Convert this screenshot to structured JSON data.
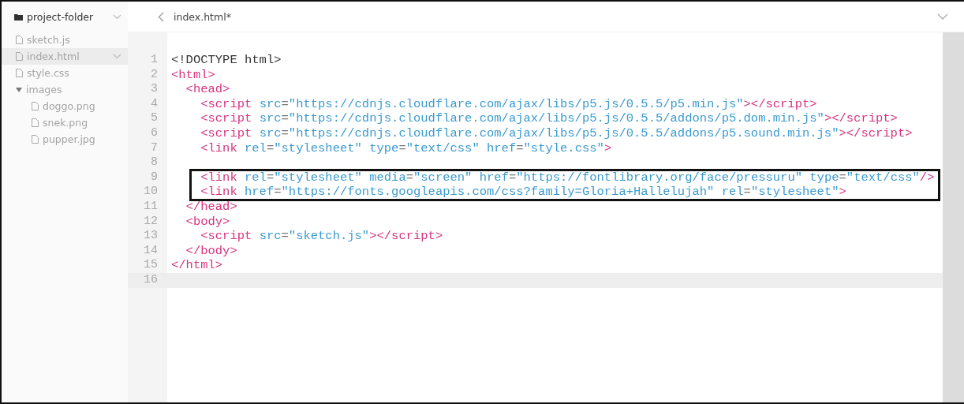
{
  "sidebar": {
    "title": "project-folder",
    "items": [
      {
        "label": "sketch.js",
        "kind": "file",
        "selected": false
      },
      {
        "label": "index.html",
        "kind": "file",
        "selected": true
      },
      {
        "label": "style.css",
        "kind": "file",
        "selected": false
      },
      {
        "label": "images",
        "kind": "folder",
        "selected": false,
        "expanded": true,
        "children": [
          {
            "label": "doggo.png",
            "kind": "file",
            "selected": false
          },
          {
            "label": "snek.png",
            "kind": "file",
            "selected": false
          },
          {
            "label": "pupper.jpg",
            "kind": "file",
            "selected": false
          }
        ]
      }
    ]
  },
  "tab": {
    "label": "index.html*"
  },
  "editor": {
    "lines": [
      {
        "number": "1",
        "current": false,
        "boxed": false,
        "tokens": [
          {
            "kind": "plain",
            "text": "<!DOCTYPE html>"
          }
        ]
      },
      {
        "number": "2",
        "current": false,
        "boxed": false,
        "tokens": [
          {
            "kind": "tag",
            "text": "<html>"
          }
        ]
      },
      {
        "number": "3",
        "current": false,
        "boxed": false,
        "tokens": [
          {
            "kind": "tag",
            "text": "  <head>"
          }
        ]
      },
      {
        "number": "4",
        "current": false,
        "boxed": false,
        "tokens": [
          {
            "kind": "tag",
            "text": "    <script"
          },
          {
            "kind": "attr",
            "text": " src"
          },
          {
            "kind": "op",
            "text": "="
          },
          {
            "kind": "str",
            "text": "\"https://cdnjs.cloudflare.com/ajax/libs/p5.js/0.5.5/p5.min.js\""
          },
          {
            "kind": "tag",
            "text": "></script>"
          }
        ]
      },
      {
        "number": "5",
        "current": false,
        "boxed": false,
        "tokens": [
          {
            "kind": "tag",
            "text": "    <script"
          },
          {
            "kind": "attr",
            "text": " src"
          },
          {
            "kind": "op",
            "text": "="
          },
          {
            "kind": "str",
            "text": "\"https://cdnjs.cloudflare.com/ajax/libs/p5.js/0.5.5/addons/p5.dom.min.js\""
          },
          {
            "kind": "tag",
            "text": "></script>"
          }
        ]
      },
      {
        "number": "6",
        "current": false,
        "boxed": false,
        "tokens": [
          {
            "kind": "tag",
            "text": "    <script"
          },
          {
            "kind": "attr",
            "text": " src"
          },
          {
            "kind": "op",
            "text": "="
          },
          {
            "kind": "str",
            "text": "\"https://cdnjs.cloudflare.com/ajax/libs/p5.js/0.5.5/addons/p5.sound.min.js\""
          },
          {
            "kind": "tag",
            "text": "></script>"
          }
        ]
      },
      {
        "number": "7",
        "current": false,
        "boxed": false,
        "tokens": [
          {
            "kind": "tag",
            "text": "    <link"
          },
          {
            "kind": "attr",
            "text": " rel"
          },
          {
            "kind": "op",
            "text": "="
          },
          {
            "kind": "str",
            "text": "\"stylesheet\""
          },
          {
            "kind": "attr",
            "text": " type"
          },
          {
            "kind": "op",
            "text": "="
          },
          {
            "kind": "str",
            "text": "\"text/css\""
          },
          {
            "kind": "attr",
            "text": " href"
          },
          {
            "kind": "op",
            "text": "="
          },
          {
            "kind": "str",
            "text": "\"style.css\""
          },
          {
            "kind": "tag",
            "text": ">"
          }
        ]
      },
      {
        "number": "8",
        "current": false,
        "boxed": false
      },
      {
        "number": "9",
        "current": false,
        "boxed": true,
        "tokens": [
          {
            "kind": "tag",
            "text": "    <link"
          },
          {
            "kind": "attr",
            "text": " rel"
          },
          {
            "kind": "op",
            "text": "="
          },
          {
            "kind": "str",
            "text": "\"stylesheet\""
          },
          {
            "kind": "attr",
            "text": " media"
          },
          {
            "kind": "op",
            "text": "="
          },
          {
            "kind": "str",
            "text": "\"screen\""
          },
          {
            "kind": "attr",
            "text": " href"
          },
          {
            "kind": "op",
            "text": "="
          },
          {
            "kind": "str",
            "text": "\"https://fontlibrary.org/face/pressuru\""
          },
          {
            "kind": "attr",
            "text": " type"
          },
          {
            "kind": "op",
            "text": "="
          },
          {
            "kind": "str",
            "text": "\"text/css\""
          },
          {
            "kind": "tag",
            "text": "/>"
          }
        ]
      },
      {
        "number": "10",
        "current": false,
        "boxed": true,
        "tokens": [
          {
            "kind": "tag",
            "text": "    <link"
          },
          {
            "kind": "attr",
            "text": " href"
          },
          {
            "kind": "op",
            "text": "="
          },
          {
            "kind": "str",
            "text": "\"https://fonts.googleapis.com/css?family=Gloria+Hallelujah\""
          },
          {
            "kind": "attr",
            "text": " rel"
          },
          {
            "kind": "op",
            "text": "="
          },
          {
            "kind": "str",
            "text": "\"stylesheet\""
          },
          {
            "kind": "tag",
            "text": ">"
          }
        ]
      },
      {
        "number": "11",
        "current": false,
        "boxed": false,
        "tokens": [
          {
            "kind": "tag",
            "text": "  </head>"
          }
        ]
      },
      {
        "number": "12",
        "current": false,
        "boxed": false,
        "tokens": [
          {
            "kind": "tag",
            "text": "  <body>"
          }
        ]
      },
      {
        "number": "13",
        "current": false,
        "boxed": false,
        "tokens": [
          {
            "kind": "tag",
            "text": "    <script"
          },
          {
            "kind": "attr",
            "text": " src"
          },
          {
            "kind": "op",
            "text": "="
          },
          {
            "kind": "str",
            "text": "\"sketch.js\""
          },
          {
            "kind": "tag",
            "text": "></script>"
          }
        ]
      },
      {
        "number": "14",
        "current": false,
        "boxed": false,
        "tokens": [
          {
            "kind": "tag",
            "text": "  </body>"
          }
        ]
      },
      {
        "number": "15",
        "current": false,
        "boxed": false,
        "tokens": [
          {
            "kind": "tag",
            "text": "</html>"
          }
        ]
      },
      {
        "number": "16",
        "current": true,
        "boxed": false
      }
    ]
  }
}
